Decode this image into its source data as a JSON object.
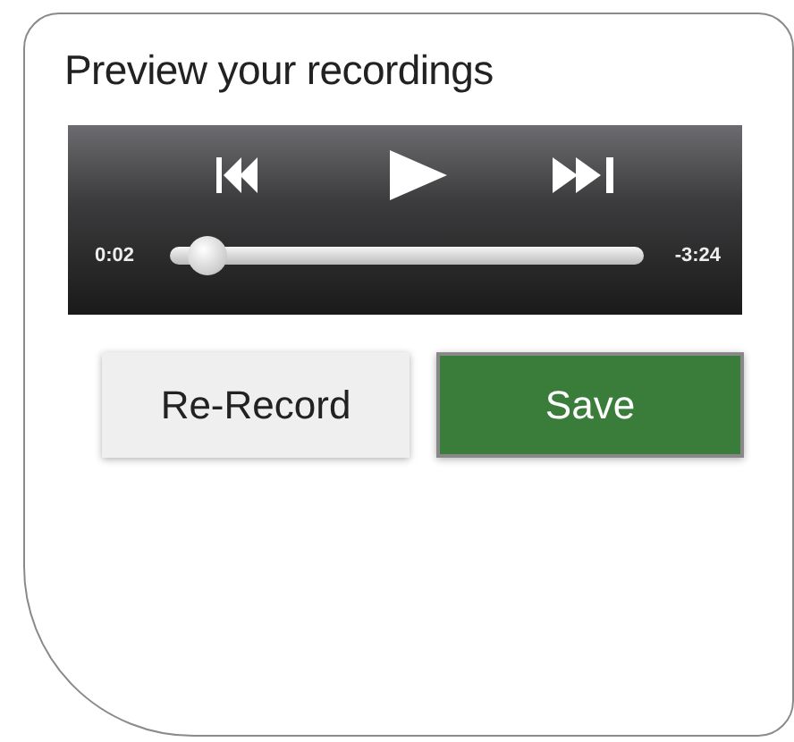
{
  "title": "Preview your recordings",
  "player": {
    "elapsed": "0:02",
    "remaining": "-3:24",
    "level": 0.04
  },
  "buttons": [
    {
      "label": "Re-Record",
      "kind": "secondary"
    },
    {
      "label": "Save",
      "kind": "primary"
    }
  ]
}
